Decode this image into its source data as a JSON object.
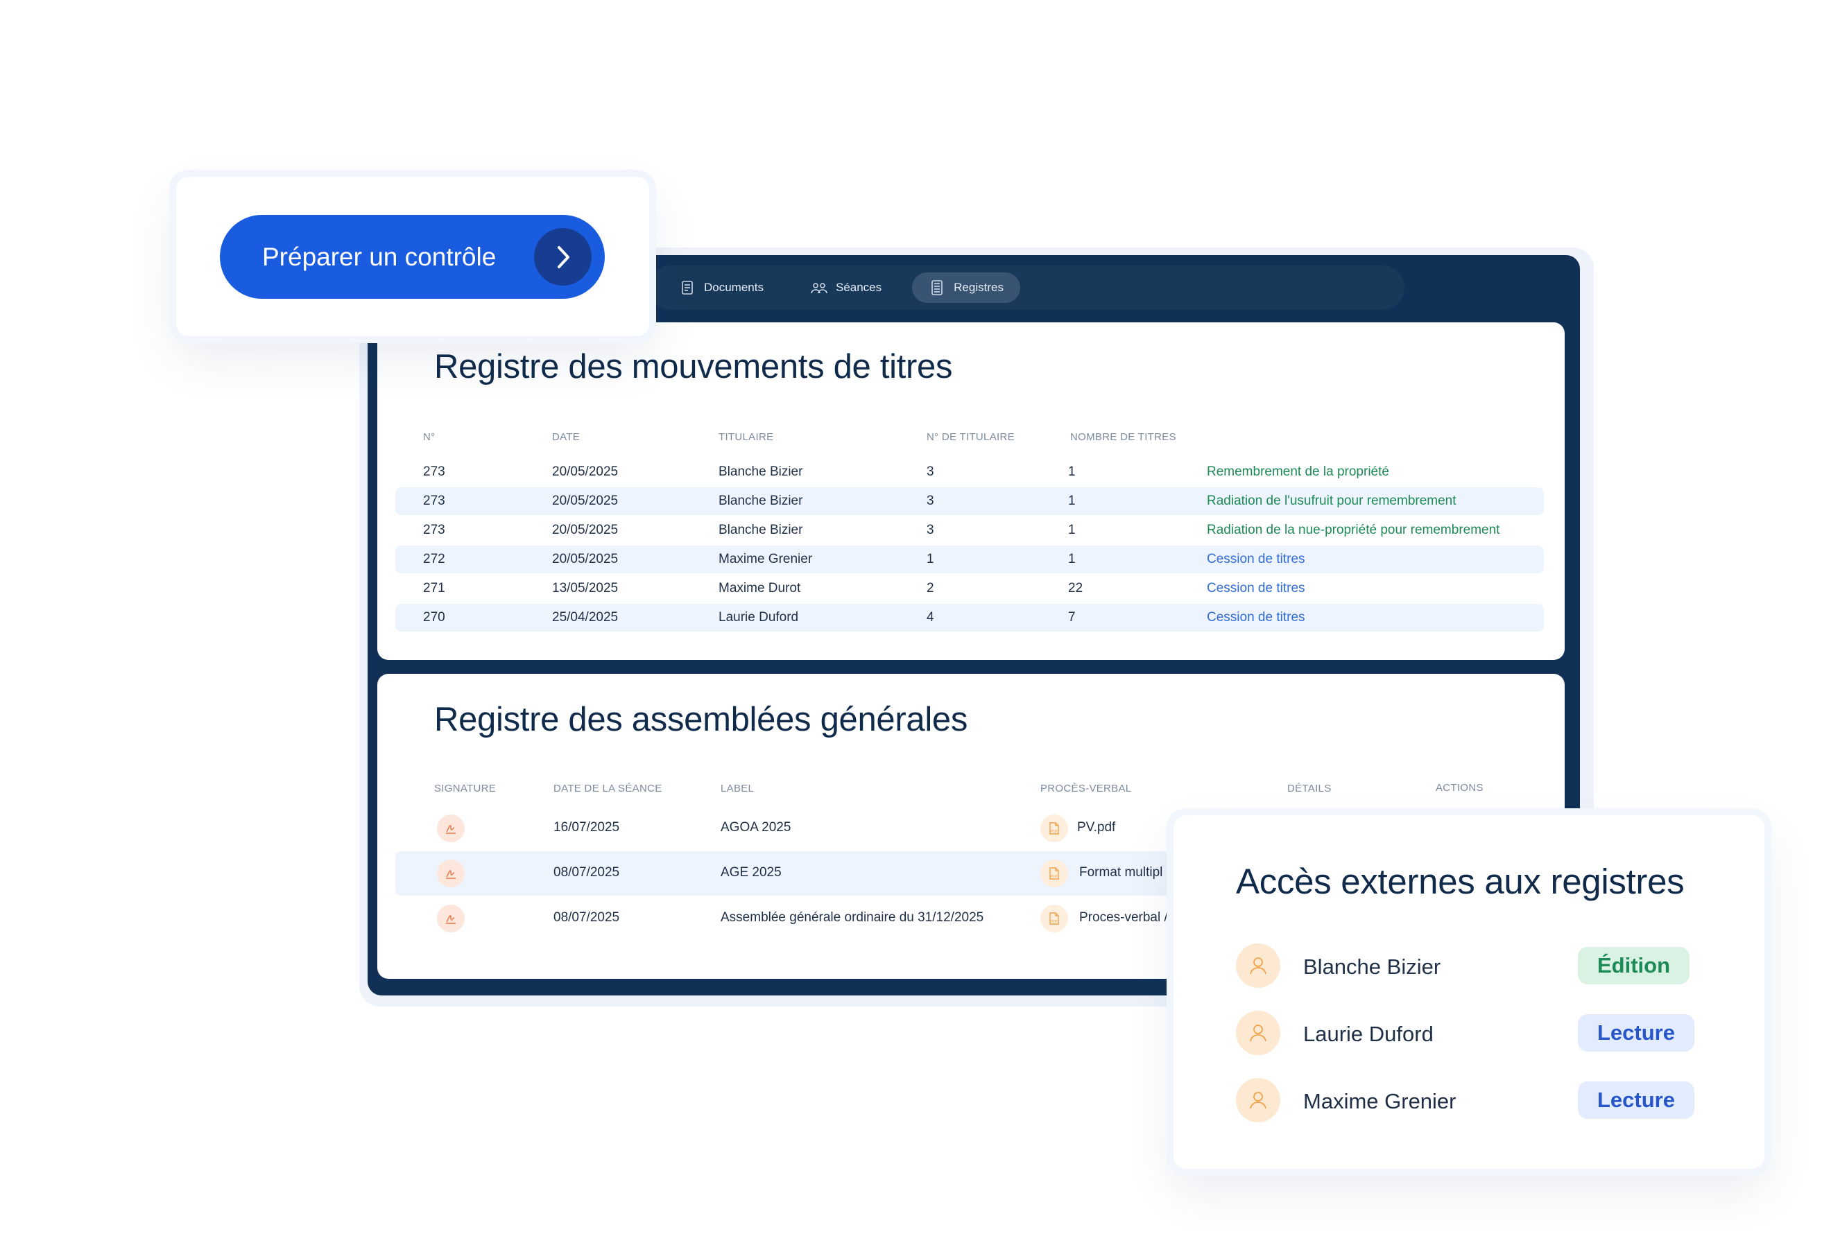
{
  "cta": {
    "label": "Préparer un contrôle"
  },
  "nav": {
    "items": [
      {
        "label": "Documents",
        "icon": "document-icon"
      },
      {
        "label": "Séances",
        "icon": "people-icon"
      },
      {
        "label": "Registres",
        "icon": "register-icon",
        "active": true
      }
    ]
  },
  "movements": {
    "title": "Registre des mouvements de titres",
    "headers": [
      "N°",
      "DATE",
      "TITULAIRE",
      "N° DE TITULAIRE",
      "NOMBRE DE TITRES"
    ],
    "rows": [
      {
        "num": "273",
        "date": "20/05/2025",
        "holder": "Blanche Bizier",
        "holder_no": "3",
        "count": "1",
        "type": "Remembrement de la propriété"
      },
      {
        "num": "273",
        "date": "20/05/2025",
        "holder": "Blanche Bizier",
        "holder_no": "3",
        "count": "1",
        "type": "Radiation de l'usufruit pour remembrement"
      },
      {
        "num": "273",
        "date": "20/05/2025",
        "holder": "Blanche Bizier",
        "holder_no": "3",
        "count": "1",
        "type": "Radiation de la nue-propriété pour remembrement"
      },
      {
        "num": "272",
        "date": "20/05/2025",
        "holder": "Maxime Grenier",
        "holder_no": "1",
        "count": "1",
        "type": "Cession de titres"
      },
      {
        "num": "271",
        "date": "13/05/2025",
        "holder": "Maxime Durot",
        "holder_no": "2",
        "count": "22",
        "type": "Cession de titres"
      },
      {
        "num": "270",
        "date": "25/04/2025",
        "holder": "Laurie Duford",
        "holder_no": "4",
        "count": "7",
        "type": "Cession de titres"
      }
    ]
  },
  "assemblies": {
    "title": "Registre des assemblées générales",
    "headers": [
      "SIGNATURE",
      "DATE DE LA SÉANCE",
      "LABEL",
      "PROCÈS-VERBAL",
      "DÉTAILS",
      "ACTIONS"
    ],
    "rows": [
      {
        "date": "16/07/2025",
        "label": "AGOA 2025",
        "pv": "PV.pdf"
      },
      {
        "date": "08/07/2025",
        "label": "AGE 2025",
        "pv": "Format multipl"
      },
      {
        "date": "08/07/2025",
        "label": "Assemblée générale ordinaire du 31/12/2025",
        "pv": "Proces-verbal /"
      }
    ]
  },
  "access": {
    "title": "Accès externes aux registres",
    "people": [
      {
        "name": "Blanche Bizier",
        "role": "Édition"
      },
      {
        "name": "Laurie Duford",
        "role": "Lecture"
      },
      {
        "name": "Maxime Grenier",
        "role": "Lecture"
      }
    ]
  },
  "colors": {
    "app_bg": "#103155",
    "primary": "#1a5ce0",
    "edit_green": "#1c8a55",
    "read_blue": "#2656c9",
    "link_blue": "#2f6bd9"
  }
}
